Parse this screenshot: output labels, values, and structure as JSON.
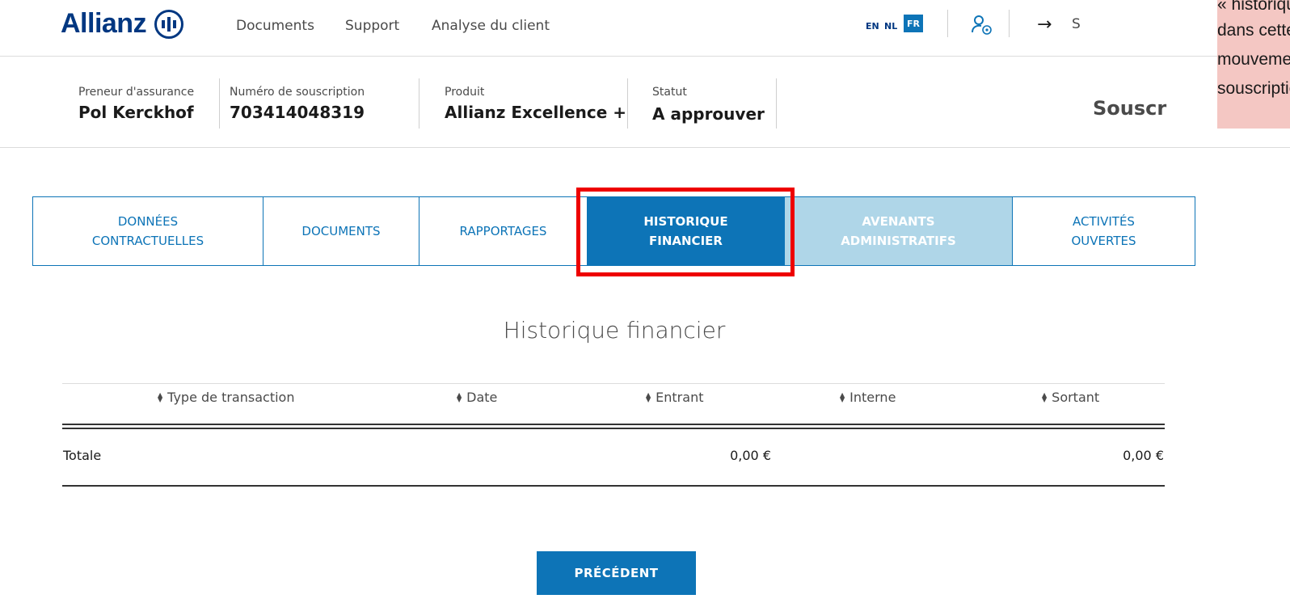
{
  "header": {
    "logo_text": "Allianz",
    "nav": [
      "Documents",
      "Support",
      "Analyse du client"
    ],
    "languages": [
      "EN",
      "NL",
      "FR"
    ],
    "active_language": "FR",
    "logout_partial": "S",
    "brand_color": "#003781"
  },
  "policy": {
    "holder_label": "Preneur d'assurance",
    "holder_value": "Pol Kerckhof",
    "number_label": "Numéro de souscription",
    "number_value": "703414048319",
    "product_label": "Produit",
    "product_value": "Allianz Excellence +",
    "status_label": "Statut",
    "status_value": "A approuver",
    "page_heading_partial": "Souscr"
  },
  "tooltip": {
    "lines": [
      "« historique financ",
      "dans cette section",
      "mouvements finan",
      "souscription."
    ],
    "color": "#f4c7c3"
  },
  "tabs": [
    {
      "label": "DONNÉES\nCONTRACTUELLES",
      "state": "normal"
    },
    {
      "label": "DOCUMENTS",
      "state": "normal"
    },
    {
      "label": "RAPPORTAGES",
      "state": "normal"
    },
    {
      "label": "HISTORIQUE\nFINANCIER",
      "state": "active"
    },
    {
      "label": "AVENANTS\nADMINISTRATIFS",
      "state": "disabled"
    },
    {
      "label": "ACTIVITÉS\nOUVERTES",
      "state": "normal"
    }
  ],
  "accent_color": "#0d74b7",
  "highlight_color": "#ee0000",
  "section": {
    "title": "Historique financier",
    "columns": [
      "Type de transaction",
      "Date",
      "Entrant",
      "Interne",
      "Sortant"
    ],
    "total_label": "Totale",
    "total_entrant": "0,00 €",
    "total_sortant": "0,00 €"
  },
  "buttons": {
    "previous": "PRÉCÉDENT"
  }
}
